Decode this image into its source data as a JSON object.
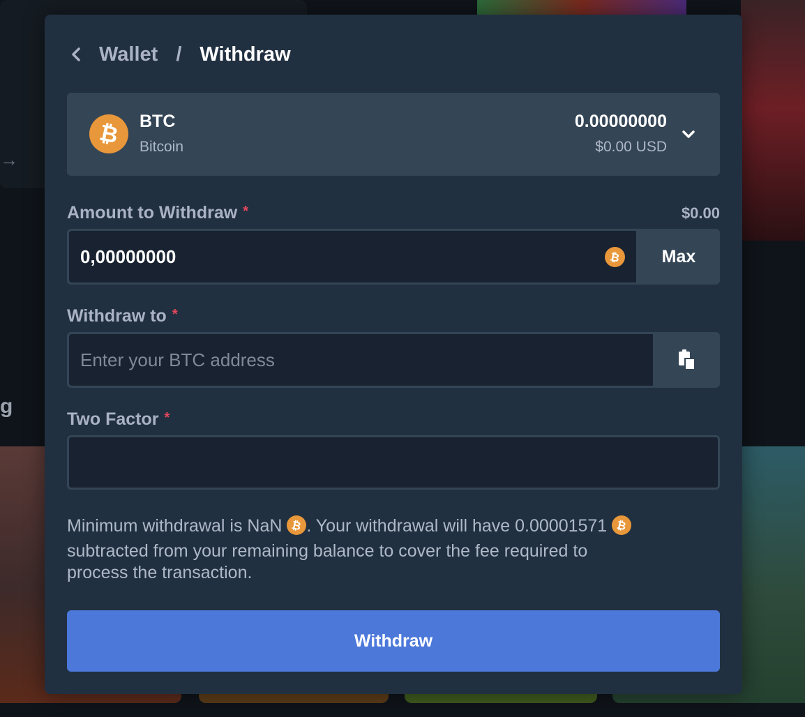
{
  "breadcrumb": {
    "parent": "Wallet",
    "separator": "/",
    "current": "Withdraw"
  },
  "currency": {
    "code": "BTC",
    "name": "Bitcoin",
    "balance": "0.00000000",
    "balance_usd": "$0.00 USD",
    "icon": "bitcoin-icon",
    "coin_color": "#e8973a"
  },
  "amount": {
    "label": "Amount to Withdraw",
    "required_mark": "*",
    "usd_value": "$0.00",
    "value": "0,00000000",
    "max_label": "Max"
  },
  "withdraw_to": {
    "label": "Withdraw to",
    "required_mark": "*",
    "placeholder": "Enter your BTC address",
    "paste_icon": "clipboard-icon"
  },
  "two_factor": {
    "label": "Two Factor",
    "required_mark": "*",
    "value": ""
  },
  "notice": {
    "part1": "Minimum withdrawal is NaN",
    "part2": ". Your withdrawal will have 0.00001571",
    "part3": "subtracted from your remaining balance to cover the fee required to",
    "part4": "process the transaction."
  },
  "submit_label": "Withdraw",
  "colors": {
    "modal_bg": "#213040",
    "input_bg": "#182230",
    "accent": "#4c78da",
    "required": "#e5475b"
  }
}
